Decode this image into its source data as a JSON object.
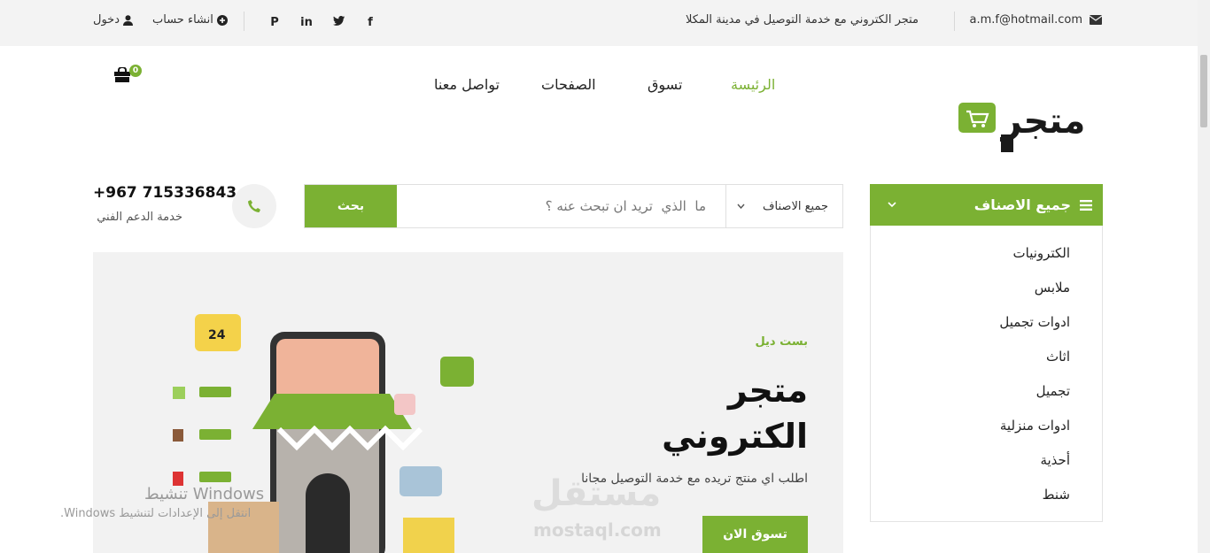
{
  "topbar": {
    "email": "a.m.f@hotmail.com",
    "tagline": "متجر الكتروني مع خدمة التوصيل في مدينة المكلا",
    "login": "دخول",
    "signup": "انشاء حساب",
    "social": [
      "facebook-icon",
      "twitter-icon",
      "linkedin-icon",
      "pinterest-icon"
    ]
  },
  "nav": {
    "home": "الرئيسة",
    "shop": "تسوق",
    "pages": "الصفحات",
    "contact": "تواصل معنا"
  },
  "cart": {
    "count": "0"
  },
  "logo_text": "متجر",
  "categories": {
    "title": "جميع الاصناف",
    "items": [
      "الكترونيات",
      "ملابس",
      "ادوات تجميل",
      "اثاث",
      "تجميل",
      "ادوات منزلية",
      "أحذية",
      "شنط"
    ]
  },
  "search": {
    "button": "بحث",
    "placeholder": "ما  الذي  تريد ان تبحث عنه ؟",
    "category_selected": "جميع الاصناف"
  },
  "support": {
    "phone": "+967 715336843",
    "label": "خدمة الدعم الفني"
  },
  "hero": {
    "eyebrow": "بست ديل",
    "title_line1": "متجر",
    "title_line2": "الكتروني",
    "subtitle": "اطلب اي منتج تريده مع خدمة التوصيل مجانا",
    "cta": "تسوق الان",
    "watermark_ar": "مستقل",
    "watermark_en": "mostaql.com"
  },
  "windows_notice": {
    "line1": "تنشيط Windows",
    "line2": "انتقل إلى الإعدادات لتنشيط Windows."
  },
  "colors": {
    "accent": "#7bb133"
  }
}
